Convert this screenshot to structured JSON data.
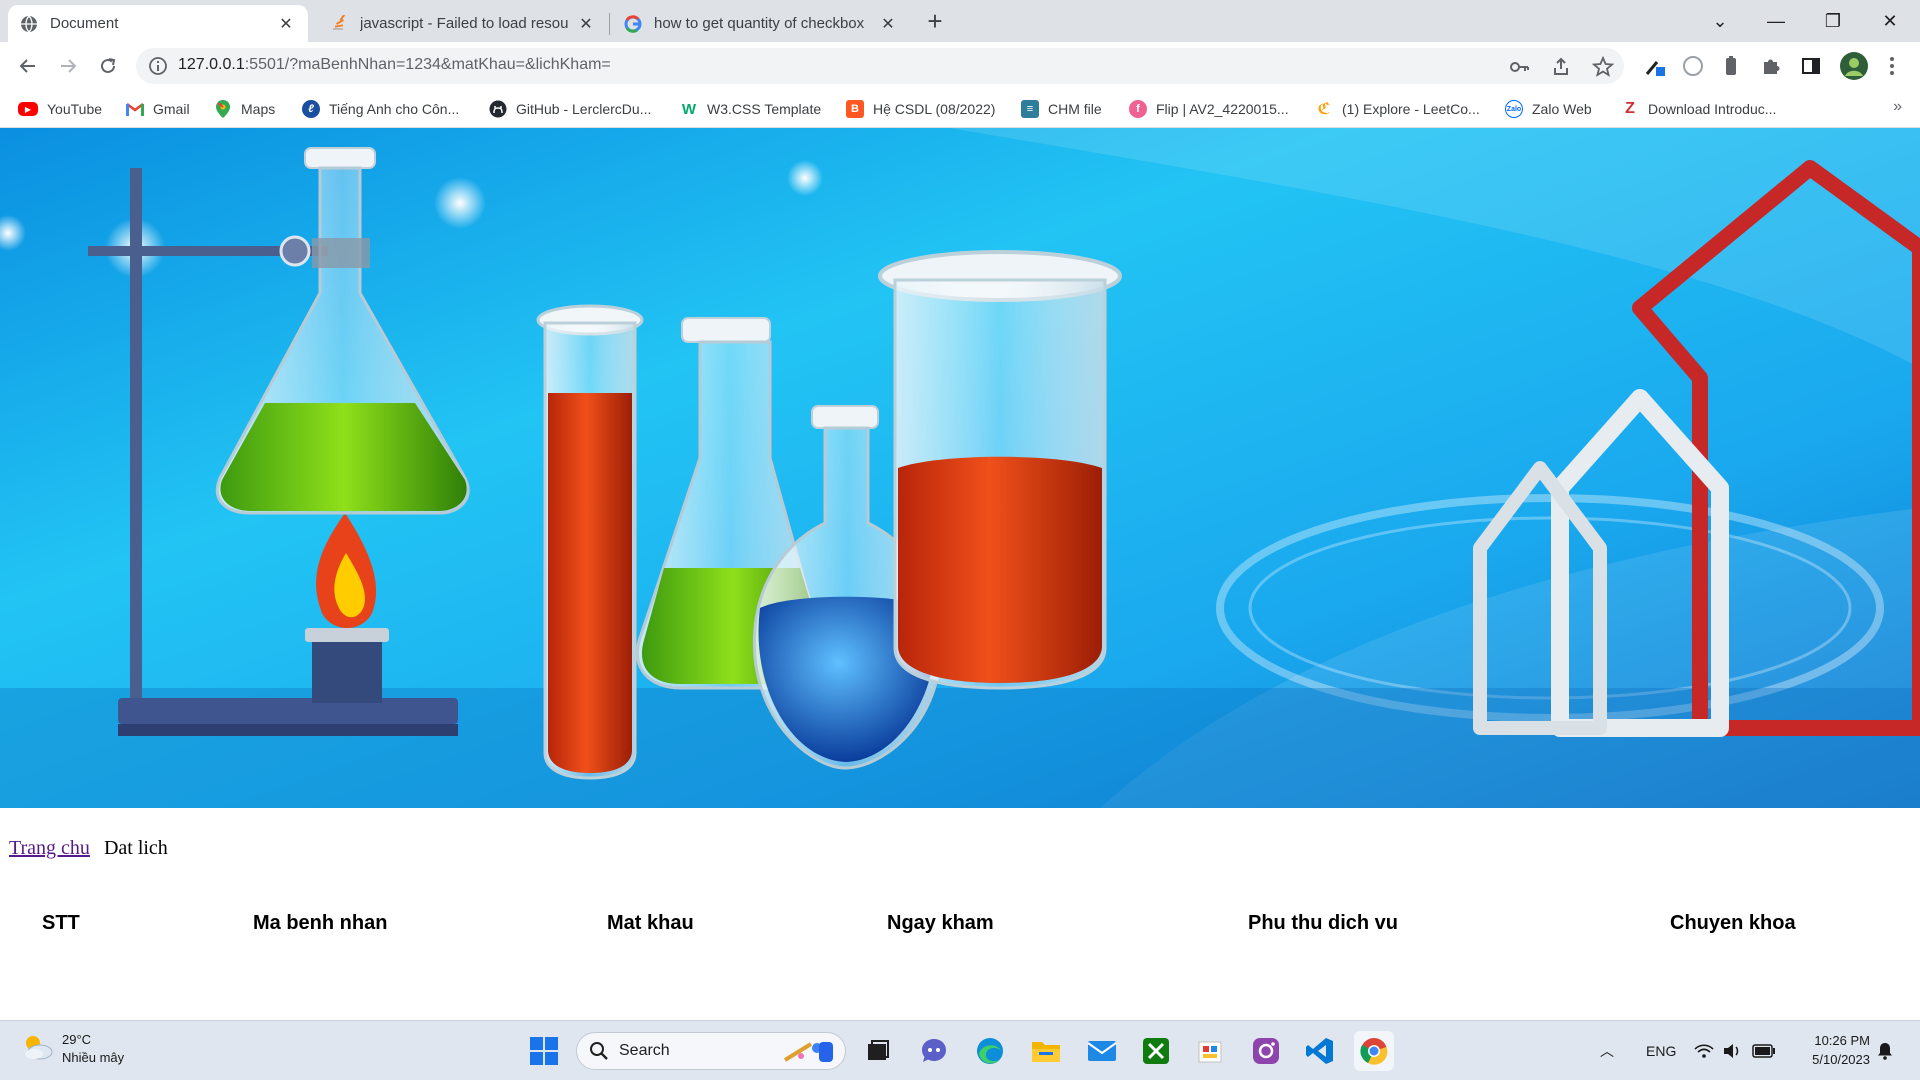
{
  "browser": {
    "tabs": [
      {
        "title": "Document",
        "active": true,
        "favicon": "globe-icon"
      },
      {
        "title": "javascript - Failed to load resourc",
        "active": false,
        "favicon": "stackoverflow-icon"
      },
      {
        "title": "how to get quantity of checkbox",
        "active": false,
        "favicon": "google-icon"
      }
    ],
    "address": {
      "host": "127.0.0.1",
      "rest": ":5501/?maBenhNhan=1234&matKhau=&lichKham="
    },
    "bookmarks": [
      {
        "label": "YouTube",
        "icon": "youtube-icon",
        "color": "#ff0000"
      },
      {
        "label": "Gmail",
        "icon": "gmail-icon",
        "color": "#ea4335"
      },
      {
        "label": "Maps",
        "icon": "maps-pin-icon",
        "color": "#34a853"
      },
      {
        "label": "Tiếng Anh cho Côn...",
        "icon": "english-course-icon",
        "color": "#1a4fa0"
      },
      {
        "label": "GitHub - LerclercDu...",
        "icon": "github-icon",
        "color": "#24292f"
      },
      {
        "label": "W3.CSS Template",
        "icon": "w3schools-icon",
        "color": "#04aa6d"
      },
      {
        "label": "Hệ CSDL (08/2022)",
        "icon": "blogger-icon",
        "color": "#ff5722"
      },
      {
        "label": "CHM file",
        "icon": "chm-file-icon",
        "color": "#2e7d9a"
      },
      {
        "label": "Flip | AV2_4220015...",
        "icon": "flip-icon",
        "color": "#f06292"
      },
      {
        "label": "(1) Explore - LeetCo...",
        "icon": "leetcode-icon",
        "color": "#ffa116"
      },
      {
        "label": "Zalo Web",
        "icon": "zalo-icon",
        "color": "#0068ff"
      },
      {
        "label": "Download Introduc...",
        "icon": "zlibrary-icon",
        "color": "#d32f2f"
      }
    ],
    "bookmarks_more": "»"
  },
  "page": {
    "nav": {
      "home_link": "Trang chu",
      "current": "Dat lich"
    },
    "table_headers": [
      "STT",
      "Ma benh nhan",
      "Mat khau",
      "Ngay kham",
      "Phu thu dich vu",
      "Chuyen khoa"
    ]
  },
  "taskbar": {
    "weather": {
      "temp": "29°C",
      "desc": "Nhiều mây"
    },
    "search_label": "Search",
    "apps": [
      "start-icon",
      "file-explorer-icon",
      "teams-chat-icon",
      "edge-icon",
      "folder-icon",
      "mail-icon",
      "xbox-icon",
      "snipping-tool-icon",
      "instagram-app-icon",
      "vscode-icon",
      "chrome-icon"
    ],
    "language": "ENG",
    "time": "10:26 PM",
    "date": "5/10/2023"
  },
  "colors": {
    "tabstrip": "#dee1e6",
    "link_visited": "#551a8b",
    "banner_sky": "#1eb4f0",
    "taskbar": "#dfe6ef"
  }
}
